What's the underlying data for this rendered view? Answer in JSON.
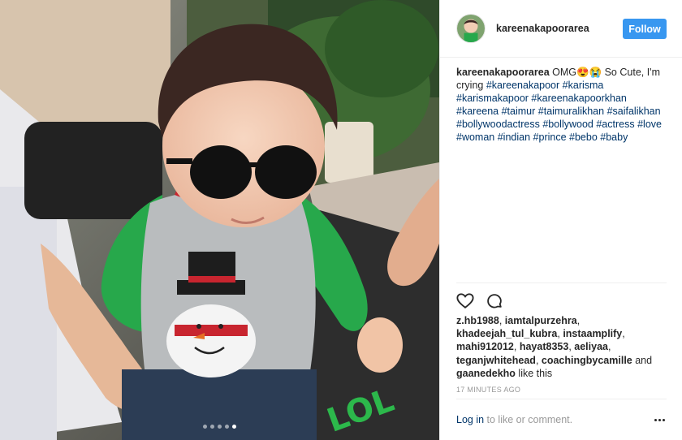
{
  "post": {
    "username": "kareenakapoorarea",
    "follow_label": "Follow",
    "caption": {
      "username": "kareenakapoorarea",
      "text": "OMG😍😭 So Cute, I'm crying",
      "hashtags": [
        "#kareenakapoor",
        "#karisma",
        "#karismakapoor",
        "#kareenakapoorkhan",
        "#kareena",
        "#taimur",
        "#taimuralikhan",
        "#saifalikhan",
        "#bollywoodactress",
        "#bollywood",
        "#actress",
        "#love",
        "#woman",
        "#indian",
        "#prince",
        "#bebo",
        "#baby"
      ]
    },
    "likes": {
      "users": [
        "z.hb1988",
        "iamtalpurzehra",
        "khadeejah_tul_kubra",
        "instaamplify",
        "mahi912012",
        "hayat8353",
        "aeliyaa",
        "teganjwhitehead",
        "coachingbycamille",
        "gaanedekho"
      ],
      "and_label": "and",
      "suffix": "like this"
    },
    "timestamp": "17 MINUTES AGO",
    "footer": {
      "login_link": "Log in",
      "login_rest": " to like or comment."
    },
    "carousel": {
      "total": 5,
      "active_index": 4
    }
  },
  "icons": {
    "like": "heart-icon",
    "comment": "comment-icon",
    "more": "more-options-icon"
  },
  "colors": {
    "follow_button": "#3897f0",
    "link": "#003569",
    "muted": "#999999",
    "text": "#262626"
  }
}
